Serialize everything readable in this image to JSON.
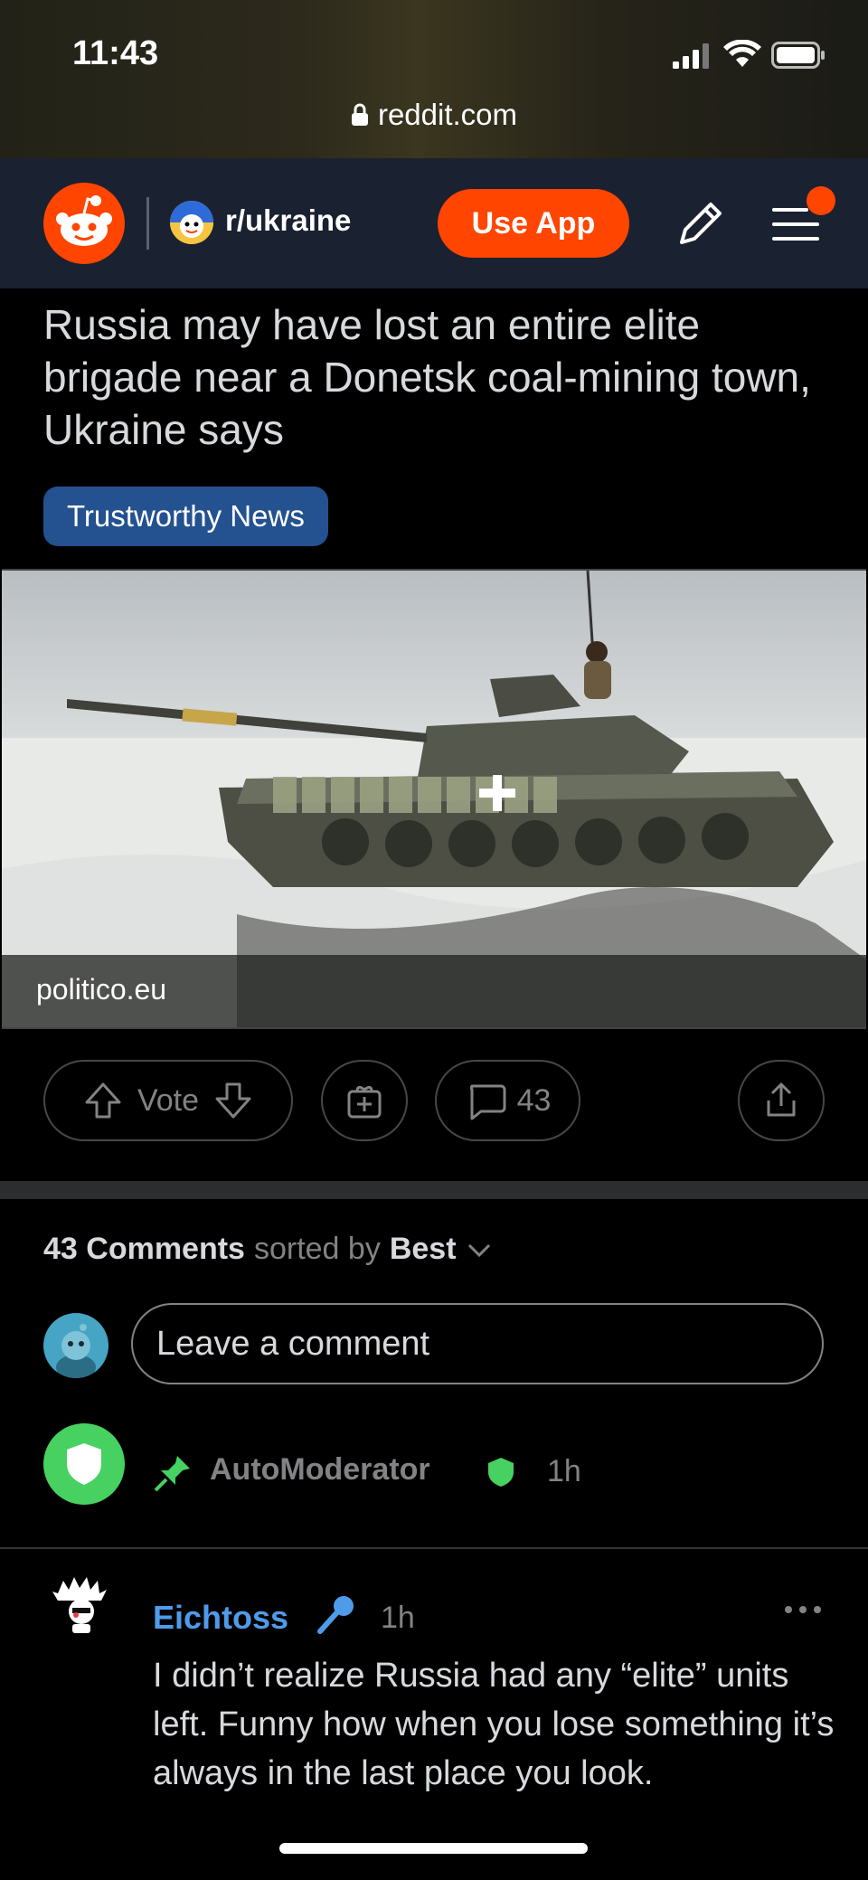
{
  "status_bar": {
    "time": "11:43",
    "url": "reddit.com"
  },
  "header": {
    "subreddit": "r/ukraine",
    "use_app_label": "Use App"
  },
  "post": {
    "title": "Russia may have lost an entire elite brigade near a Donetsk coal-mining town, Ukraine says",
    "flair": "Trustworthy News",
    "domain": "politico.eu",
    "vote_label": "Vote",
    "comment_count": "43"
  },
  "comments_section": {
    "count_label": "43 Comments",
    "sorted_by_label": "sorted by",
    "sort_value": "Best",
    "input_placeholder": "Leave a comment"
  },
  "automod": {
    "name": "AutoModerator",
    "time": "1h"
  },
  "comment": {
    "author": "Eichtoss",
    "time": "1h",
    "body": "I didn’t realize Russia had any “elite” units left. Funny how when you lose something it’s always in the last place you look."
  },
  "colors": {
    "brand_orange": "#ff4500",
    "header_bg": "#1a2131",
    "flair_blue": "#24518f",
    "mod_green": "#46d160",
    "username_blue": "#4f9bea"
  }
}
